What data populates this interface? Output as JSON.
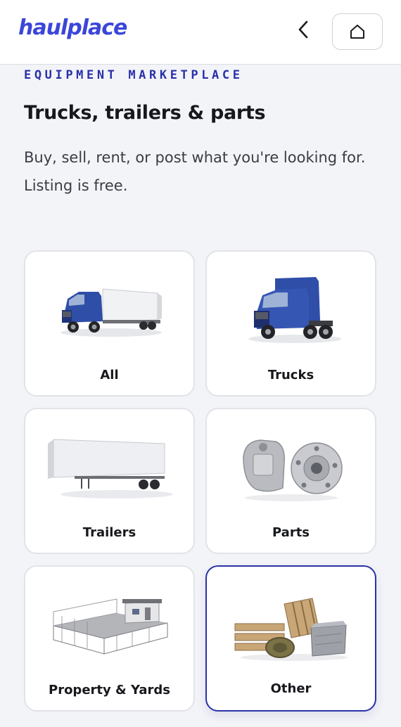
{
  "header": {
    "logo": "haulplace",
    "back_icon": "chevron-left-icon",
    "home_icon": "home-icon"
  },
  "intro": {
    "eyebrow": "EQUIPMENT MARKETPLACE",
    "title": "Trucks, trailers & parts",
    "subtitle": "Buy, sell, rent, or post what you're looking for. Listing is free."
  },
  "categories": [
    {
      "label": "All",
      "image": "semi-truck-with-trailer",
      "selected": false
    },
    {
      "label": "Trucks",
      "image": "semi-truck-cab",
      "selected": false
    },
    {
      "label": "Trailers",
      "image": "dry-van-trailer",
      "selected": false
    },
    {
      "label": "Parts",
      "image": "brake-caliper-and-wheel-hub",
      "selected": false
    },
    {
      "label": "Property & Yards",
      "image": "fenced-yard-with-office",
      "selected": false
    },
    {
      "label": "Other",
      "image": "pallets-straps-and-crate",
      "selected": true
    }
  ],
  "colors": {
    "brand": "#3b46d9",
    "accent": "#2a31a8",
    "truck_blue": "#2f4ea8",
    "background": "#f3f4f8"
  }
}
